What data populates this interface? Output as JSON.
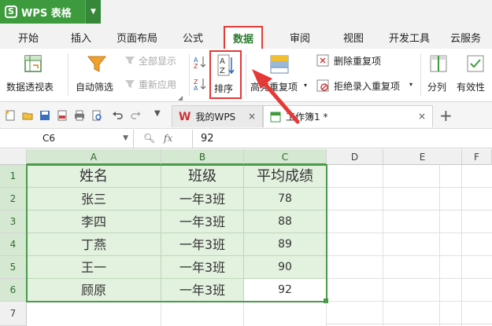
{
  "app": {
    "name": "WPS 表格",
    "logo_letter": "S"
  },
  "tabs": [
    "开始",
    "插入",
    "页面布局",
    "公式",
    "数据",
    "审阅",
    "视图",
    "开发工具",
    "云服务"
  ],
  "active_tab": "数据",
  "ribbon": {
    "pivot_label": "数据透视表",
    "autofilter_label": "自动筛选",
    "show_all_label": "全部显示",
    "reapply_label": "重新应用",
    "sort_label": "排序",
    "highlight_dup_label": "高亮重复项",
    "remove_dup_label": "删除重复项",
    "reject_dup_label": "拒绝录入重复项",
    "split_label": "分列",
    "validity_label": "有效性"
  },
  "doc_tabs": [
    {
      "label": "我的WPS",
      "close": "×"
    },
    {
      "label": "工作簿1 *",
      "close": "×"
    }
  ],
  "new_tab_symbol": "+",
  "formula_bar": {
    "cell_ref": "C6",
    "fx": "fx",
    "value": "92"
  },
  "grid": {
    "columns": [
      "A",
      "B",
      "C",
      "D",
      "E",
      "F"
    ],
    "rows": [
      "1",
      "2",
      "3",
      "4",
      "5",
      "6",
      "7"
    ],
    "header": [
      "姓名",
      "班级",
      "平均成绩"
    ],
    "data": [
      [
        "张三",
        "一年3班",
        "78"
      ],
      [
        "李四",
        "一年3班",
        "88"
      ],
      [
        "丁燕",
        "一年3班",
        "89"
      ],
      [
        "王一",
        "一年3班",
        "90"
      ],
      [
        "顾原",
        "一年3班",
        "92"
      ]
    ]
  },
  "colors": {
    "brand": "#3d9b3d",
    "highlight": "#e53935",
    "selection": "#4a9a4a"
  }
}
